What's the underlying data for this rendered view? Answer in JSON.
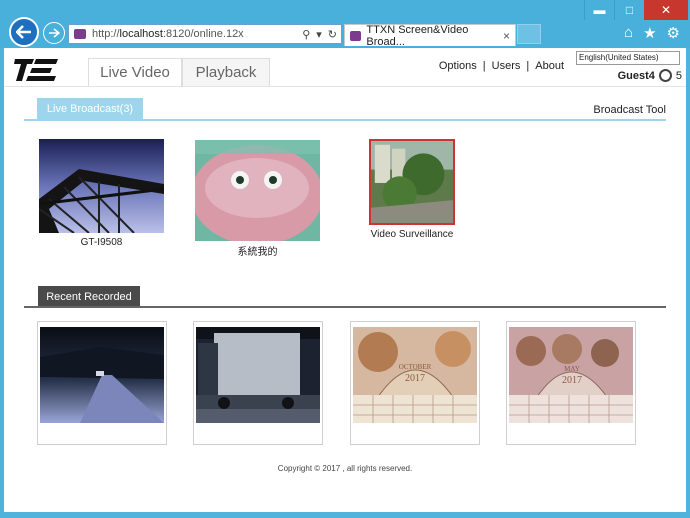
{
  "browser": {
    "address_host": "localhost",
    "address_prefix": "http://",
    "address_suffix": ":8120/online.12x",
    "tab_title": "TTXN Screen&Video Broad...",
    "tab_close": "×"
  },
  "window": {
    "minimize": "▬",
    "maximize": "□",
    "close": "✕"
  },
  "header": {
    "tabs": [
      {
        "label": "Live Video"
      },
      {
        "label": "Playback"
      }
    ],
    "links": {
      "options": "Options",
      "sep1": "|",
      "users": "Users",
      "sep2": "|",
      "about": "About"
    },
    "language": "English(United States)",
    "user_name": "Guest4",
    "online_count": "5"
  },
  "live": {
    "section_label": "Live Broadcast(3)",
    "broadcast_tool": "Broadcast Tool",
    "items": [
      {
        "caption": "GT-I9508"
      },
      {
        "caption": "系統我的"
      },
      {
        "caption": "Video Surveillance"
      }
    ]
  },
  "recent": {
    "section_label": "Recent Recorded",
    "calendar_month_1": "OCTOBER",
    "calendar_year_1": "2017",
    "calendar_month_2": "MAY",
    "calendar_year_2": "2017"
  },
  "footer": {
    "copyright": "Copyright © 2017 , all rights reserved."
  }
}
